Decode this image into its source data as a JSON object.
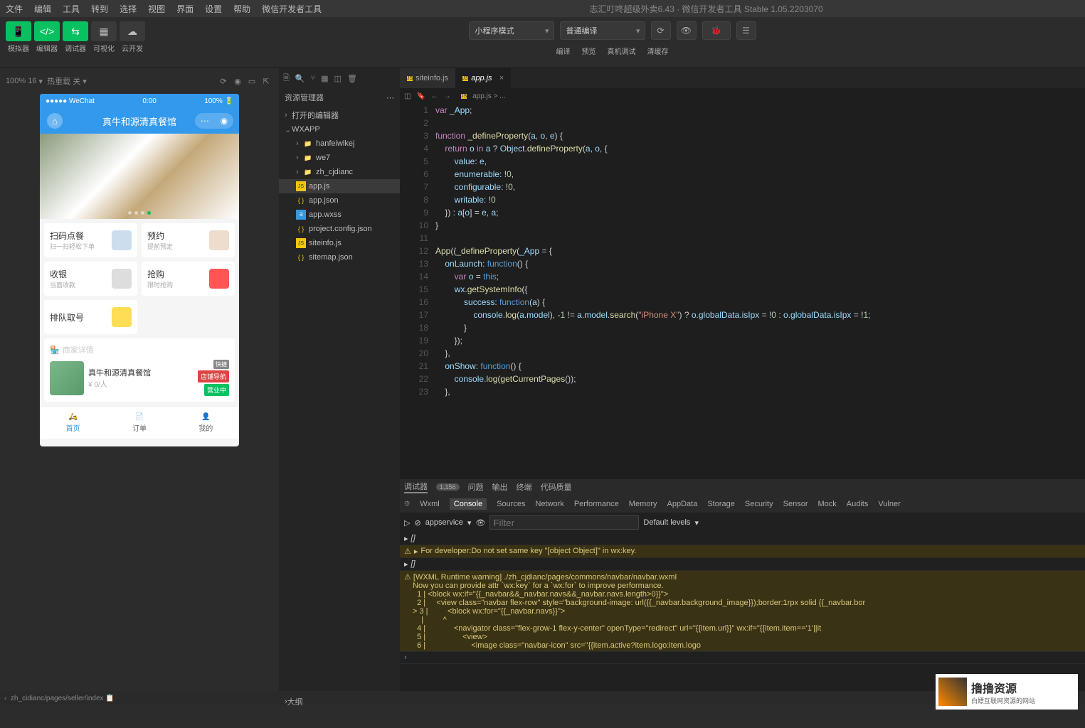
{
  "menu": {
    "items": [
      "文件",
      "编辑",
      "工具",
      "转到",
      "选择",
      "视图",
      "界面",
      "设置",
      "帮助",
      "微信开发者工具"
    ],
    "title": "志汇叮咚超级外卖6.43 · 微信开发者工具 Stable 1.05.2203070"
  },
  "toolbar": {
    "sim": "模拟器",
    "editor": "编辑器",
    "debug": "调试器",
    "visual": "可视化",
    "cloud": "云开发",
    "select1": "小程序模式",
    "select2": "普通编译",
    "compile": "编译",
    "preview": "预览",
    "realdebug": "真机调试",
    "clearcache": "清缓存"
  },
  "simhdr": {
    "zoom": "100% 16",
    "hot": "热重载 关"
  },
  "phone": {
    "status": {
      "left": "●●●●● WeChat",
      "time": "0:00",
      "bat": "100%"
    },
    "title": "真牛和源清真餐馆",
    "cards": [
      {
        "t": "扫码点餐",
        "s": "扫一扫轻松下单"
      },
      {
        "t": "预约",
        "s": "提前预定"
      },
      {
        "t": "收银",
        "s": "当面收款"
      },
      {
        "t": "抢购",
        "s": "限时抢购"
      },
      {
        "t": "排队取号",
        "s": ""
      }
    ],
    "shop": {
      "hdr": "商家详情",
      "name": "真牛和源清真餐馆",
      "price": "¥ 0/人",
      "badge1": "店铺导航",
      "badge2": "营业中",
      "quick": "快捷"
    },
    "nav": [
      "首页",
      "订单",
      "我的"
    ]
  },
  "explorer": {
    "title": "资源管理器",
    "outline": "大纲",
    "open": "打开的编辑器",
    "root": "WXAPP",
    "items": [
      {
        "n": "hanfeiwlkej",
        "t": "folder",
        "i": 1
      },
      {
        "n": "we7",
        "t": "folder",
        "i": 1
      },
      {
        "n": "zh_cjdianc",
        "t": "folder",
        "i": 1
      },
      {
        "n": "app.js",
        "t": "js",
        "i": 1,
        "sel": true
      },
      {
        "n": "app.json",
        "t": "json",
        "i": 1
      },
      {
        "n": "app.wxss",
        "t": "wxss",
        "i": 1
      },
      {
        "n": "project.config.json",
        "t": "json",
        "i": 1
      },
      {
        "n": "siteinfo.js",
        "t": "js",
        "i": 1
      },
      {
        "n": "sitemap.json",
        "t": "json",
        "i": 1
      }
    ]
  },
  "tabs": [
    {
      "n": "siteinfo.js",
      "act": false
    },
    {
      "n": "app.js",
      "act": true
    }
  ],
  "breadcrumb": "app.js > ...",
  "code": [
    {
      "l": 1,
      "h": "<span class='kw'>var</span> <span class='va'>_App</span>;"
    },
    {
      "l": 2,
      "h": ""
    },
    {
      "l": 3,
      "h": "<span class='kw'>function</span> <span class='fn'>_defineProperty</span>(<span class='va'>a</span>, <span class='va'>o</span>, <span class='va'>e</span>) {"
    },
    {
      "l": 4,
      "h": "    <span class='kw'>return</span> <span class='va'>o</span> <span class='kw'>in</span> <span class='va'>a</span> ? <span class='va'>Object</span>.<span class='fn'>defineProperty</span>(<span class='va'>a</span>, <span class='va'>o</span>, {"
    },
    {
      "l": 5,
      "h": "        <span class='pr'>value</span>: <span class='va'>e</span>,"
    },
    {
      "l": 6,
      "h": "        <span class='pr'>enumerable</span>: !<span class='nu'>0</span>,"
    },
    {
      "l": 7,
      "h": "        <span class='pr'>configurable</span>: !<span class='nu'>0</span>,"
    },
    {
      "l": 8,
      "h": "        <span class='pr'>writable</span>: !<span class='nu'>0</span>"
    },
    {
      "l": 9,
      "h": "    }) : <span class='va'>a</span>[<span class='va'>o</span>] = <span class='va'>e</span>, <span class='va'>a</span>;"
    },
    {
      "l": 10,
      "h": "}"
    },
    {
      "l": 11,
      "h": ""
    },
    {
      "l": 12,
      "h": "<span class='fn'>App</span>((<span class='fn'>_defineProperty</span>(<span class='va'>_App</span> = {"
    },
    {
      "l": 13,
      "h": "    <span class='pr'>onLaunch</span>: <span class='bl'>function</span>() {"
    },
    {
      "l": 14,
      "h": "        <span class='kw'>var</span> <span class='va'>o</span> = <span class='bl'>this</span>;"
    },
    {
      "l": 15,
      "h": "        <span class='va'>wx</span>.<span class='fn'>getSystemInfo</span>({"
    },
    {
      "l": 16,
      "h": "            <span class='pr'>success</span>: <span class='bl'>function</span>(<span class='va'>a</span>) {"
    },
    {
      "l": 17,
      "h": "                <span class='va'>console</span>.<span class='fn'>log</span>(<span class='va'>a</span>.<span class='va'>model</span>), -<span class='nu'>1</span> != <span class='va'>a</span>.<span class='va'>model</span>.<span class='fn'>search</span>(<span class='st'>\"iPhone X\"</span>) ? <span class='va'>o</span>.<span class='va'>globalData</span>.<span class='va'>isIpx</span> = !<span class='nu'>0</span> : <span class='va'>o</span>.<span class='va'>globalData</span>.<span class='va'>isIpx</span> = !<span class='nu'>1</span>;"
    },
    {
      "l": 18,
      "h": "            }"
    },
    {
      "l": 19,
      "h": "        });"
    },
    {
      "l": 20,
      "h": "    },"
    },
    {
      "l": 21,
      "h": "    <span class='pr'>onShow</span>: <span class='bl'>function</span>() {"
    },
    {
      "l": 22,
      "h": "        <span class='va'>console</span>.<span class='fn'>log</span>(<span class='fn'>getCurrentPages</span>());"
    },
    {
      "l": 23,
      "h": "    },"
    }
  ],
  "devtools": {
    "hdr": {
      "debug": "调试器",
      "count": "1,156",
      "wenti": "问题",
      "out": "输出",
      "term": "终端",
      "quality": "代码质量"
    },
    "tabs": [
      "Wxml",
      "Console",
      "Sources",
      "Network",
      "Performance",
      "Memory",
      "AppData",
      "Storage",
      "Security",
      "Sensor",
      "Mock",
      "Audits",
      "Vulner"
    ],
    "context": "appservice",
    "filter_ph": "Filter",
    "levels": "Default levels",
    "msg1": "For developer:Do not set same key \"[object Object]\" in wx:key.",
    "warn_hdr": "[WXML Runtime warning] ./zh_cjdianc/pages/commons/navbar/navbar.wxml",
    "warn_sub": "Now you can provide attr `wx:key` for a `wx:for` to improve performance.",
    "warn_lines": [
      "  1 | <block wx:if=\"{{_navbar&&_navbar.navs&&_navbar.navs.length>0}}\">",
      "  2 |     <view class=\"navbar flex-row\" style=\"background-image: url({{_navbar.background_image}});border:1rpx solid {{_navbar.bor",
      "> 3 |         <block wx:for=\"{{_navbar.navs}}\">",
      "    |         ^",
      "  4 |             <navigator class=\"flex-grow-1 flex-y-center\" openType=\"redirect\" url=\"{{item.url}}\" wx:if=\"{{item.item=='1'||it",
      "  5 |                 <view>",
      "  6 |                     <image class=\"navbar-icon\" src=\"{{item.active?item.logo:item.logo"
    ]
  },
  "statusbar": {
    "path": "zh_cidianc/pages/seller/index"
  },
  "watermark": {
    "t1": "撸撸资源",
    "t2": "白嫖互联网资源的网站"
  }
}
